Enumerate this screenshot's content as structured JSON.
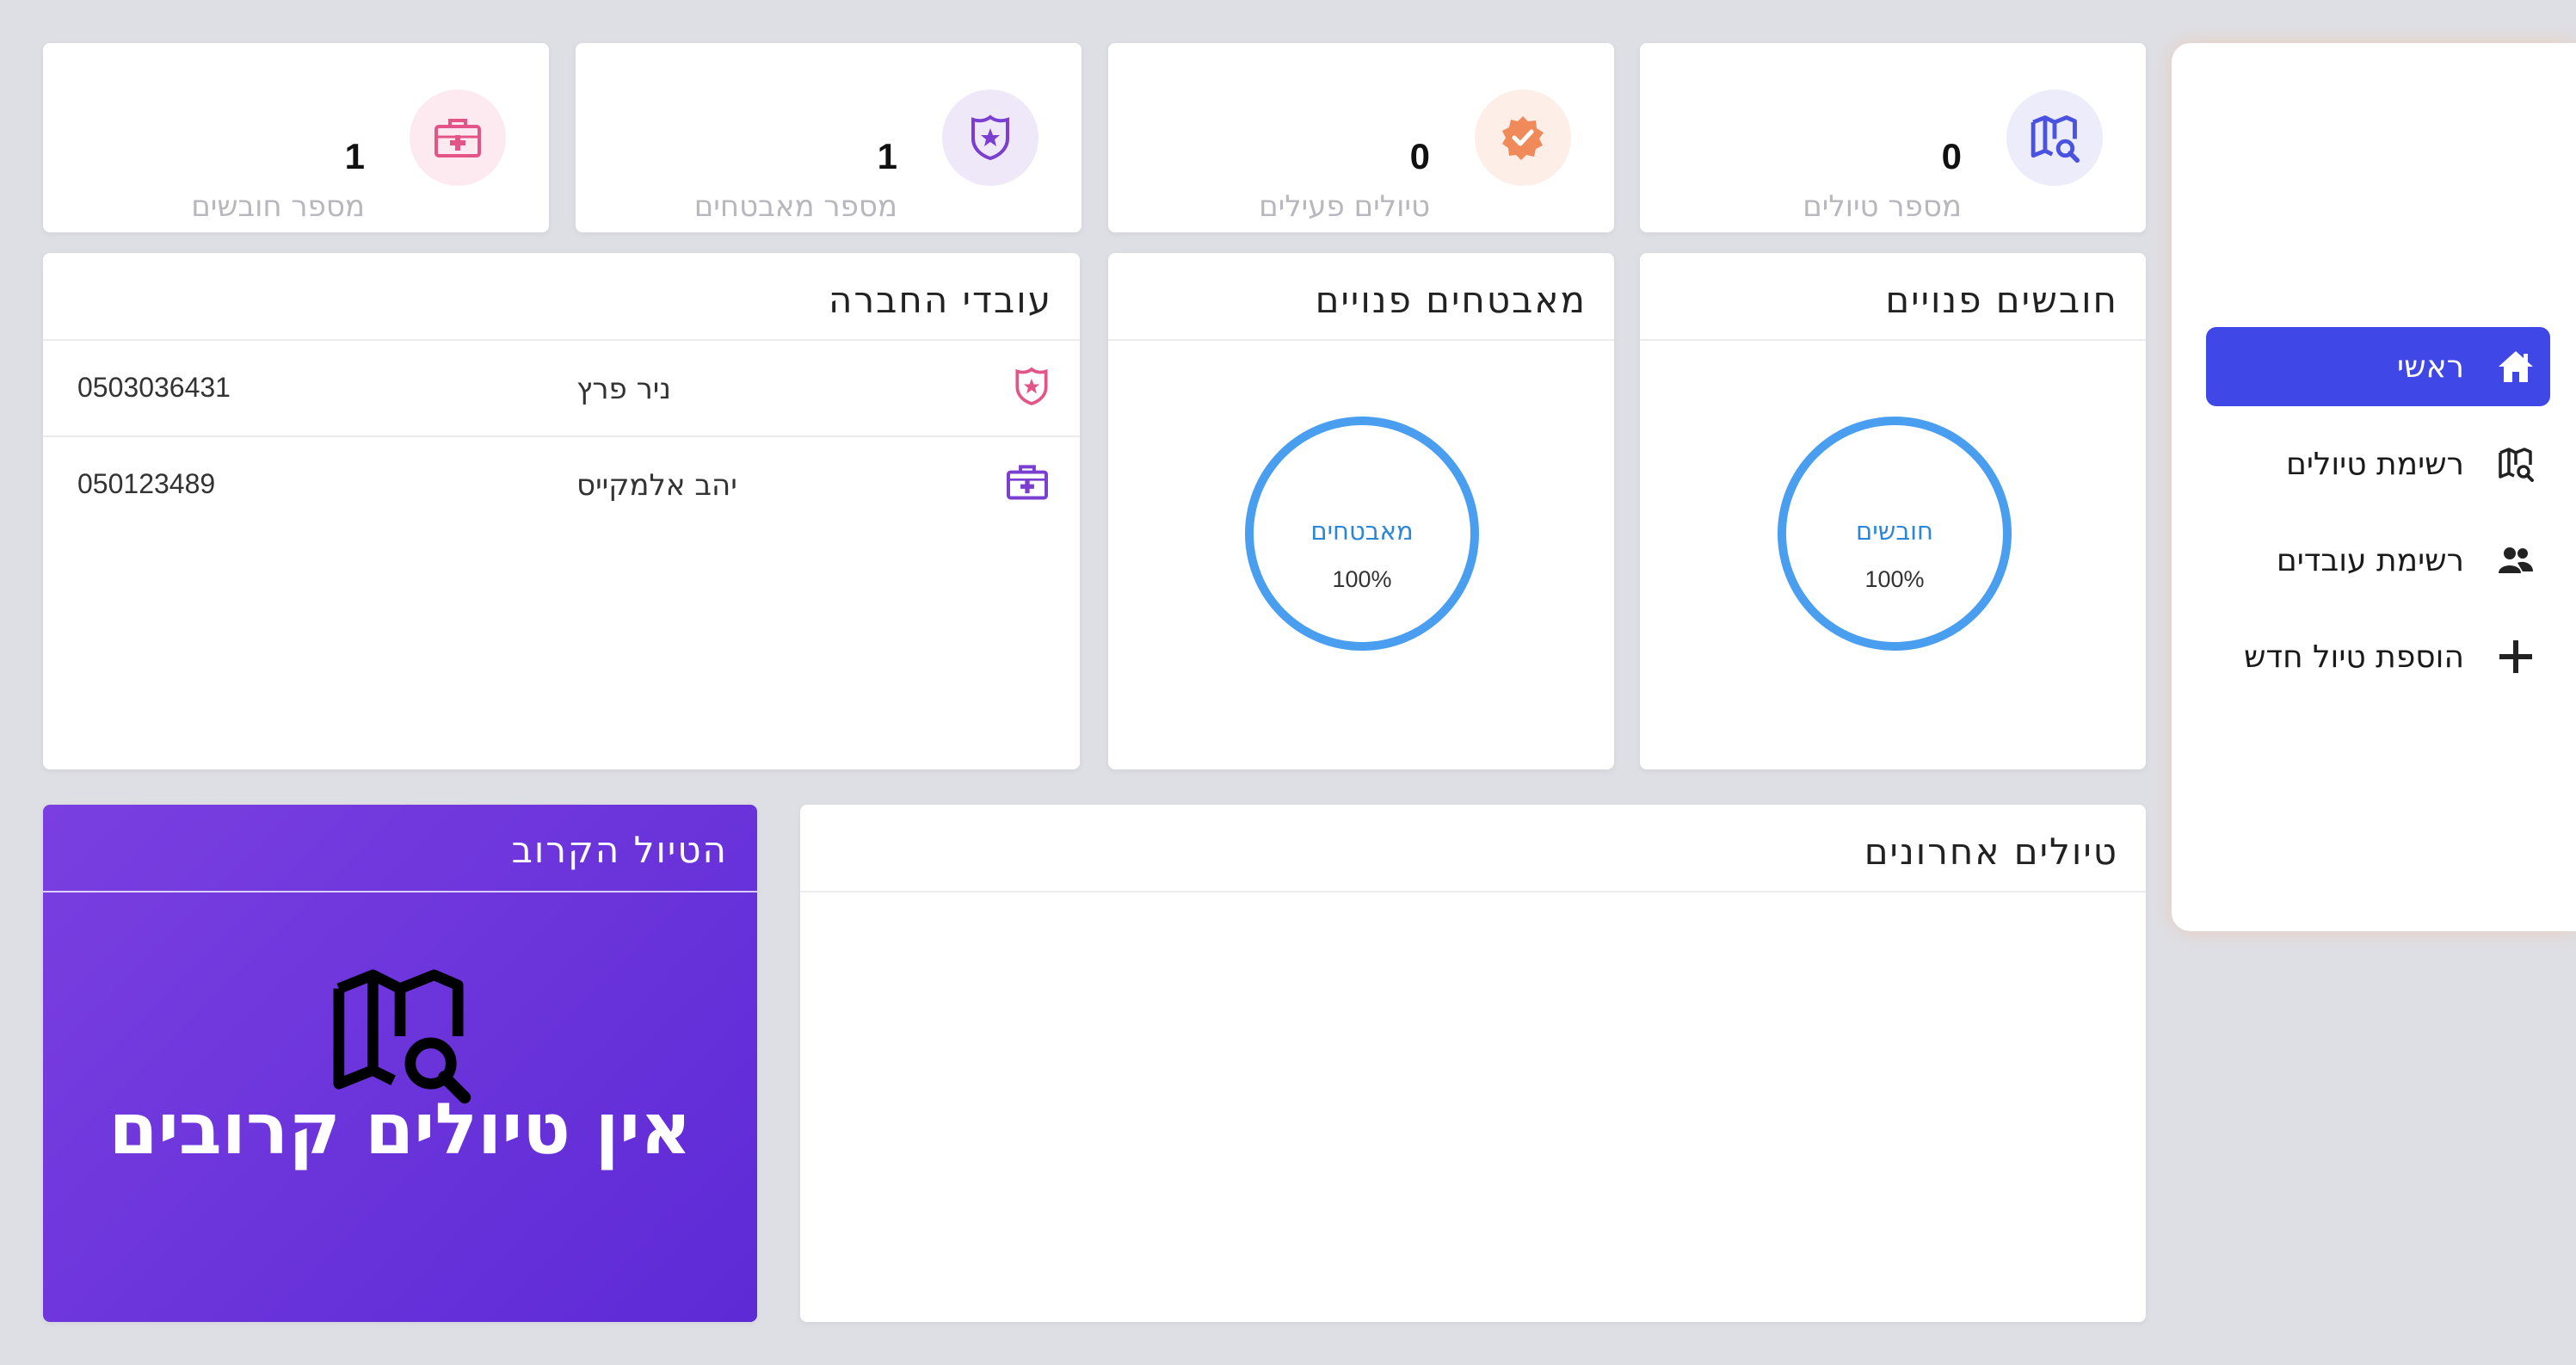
{
  "sidebar": {
    "items": [
      {
        "label": "ראשי",
        "icon": "home-icon",
        "active": true
      },
      {
        "label": "רשימת טיולים",
        "icon": "map-search-icon",
        "active": false
      },
      {
        "label": "רשימת עובדים",
        "icon": "users-icon",
        "active": false
      },
      {
        "label": "הוספת טיול חדש",
        "icon": "plus-icon",
        "active": false
      }
    ]
  },
  "stats": [
    {
      "label": "מספר טיולים",
      "value": "0",
      "icon": "map-search-icon",
      "color": "#4a52e0",
      "bg": "#ececfb"
    },
    {
      "label": "טיולים פעילים",
      "value": "0",
      "icon": "verified-badge-icon",
      "color": "#f08a5a",
      "bg": "#fdefe8"
    },
    {
      "label": "מספר מאבטחים",
      "value": "1",
      "icon": "police-badge-icon",
      "color": "#7a3fd0",
      "bg": "#eee8f8"
    },
    {
      "label": "מספר חובשים",
      "value": "1",
      "icon": "medkit-icon",
      "color": "#e25586",
      "bg": "#fdeaf0"
    }
  ],
  "free_medics": {
    "title": "חובשים פנויים",
    "donut_label": "חובשים",
    "percent": "100%",
    "color": "#4a9ef0"
  },
  "free_guards": {
    "title": "מאבטחים פנויים",
    "donut_label": "מאבטחים",
    "percent": "100%",
    "color": "#4a9ef0"
  },
  "employees": {
    "title": "עובדי החברה",
    "rows": [
      {
        "name": "ניר פרץ",
        "phone": "0503036431",
        "icon": "police-badge-icon"
      },
      {
        "name": "יהב אלמקייס",
        "phone": "050123489",
        "icon": "medkit-icon"
      }
    ]
  },
  "recent_trips": {
    "title": "טיולים אחרונים"
  },
  "upcoming_trip": {
    "title": "הטיול הקרוב",
    "empty_text": "אין טיולים קרובים",
    "icon": "map-search-icon"
  }
}
